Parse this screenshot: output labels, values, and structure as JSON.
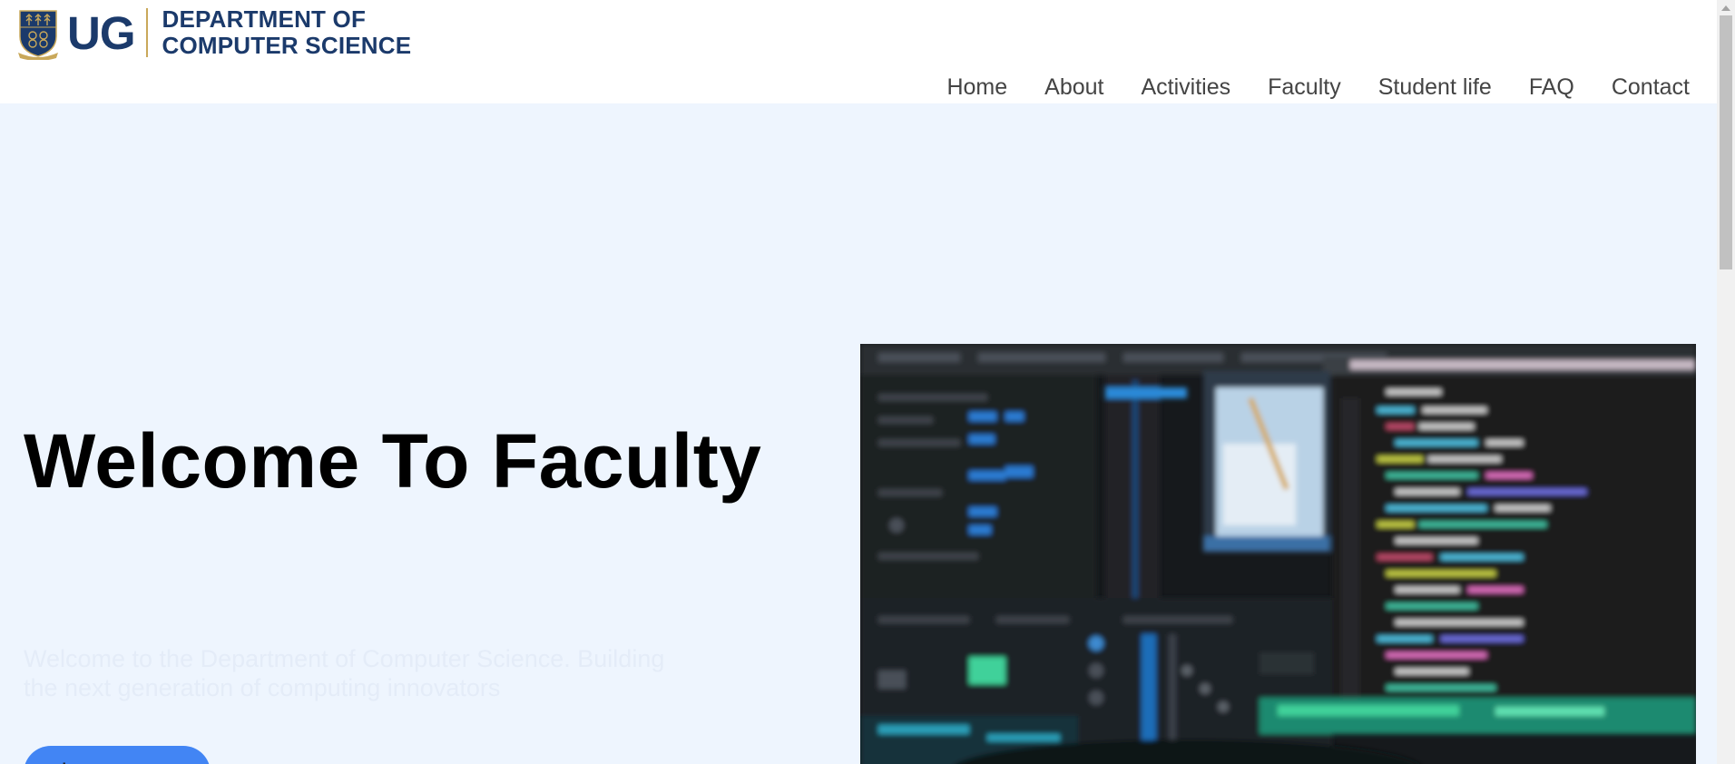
{
  "header": {
    "logo": {
      "crest_icon": "university-crest-icon",
      "short_name": "UG",
      "dept_line1": "DEPARTMENT OF",
      "dept_line2": "COMPUTER SCIENCE"
    },
    "nav": [
      {
        "label": "Home"
      },
      {
        "label": "About"
      },
      {
        "label": "Activities"
      },
      {
        "label": "Faculty"
      },
      {
        "label": "Student life"
      },
      {
        "label": "FAQ"
      },
      {
        "label": "Contact"
      }
    ]
  },
  "hero": {
    "title": "Welcome To Faculty",
    "subtitle": "Welcome to the Department of Computer Science. Building the next generation of computing innovators",
    "button_label": "Learn more",
    "image": "blurred-code-monitor-photo"
  },
  "colors": {
    "brand_navy": "#1b3a6b",
    "crest_gold": "#c9a85a",
    "hero_bg": "#eef5fe",
    "button_blue": "#4285f4",
    "nav_text": "#444444"
  }
}
